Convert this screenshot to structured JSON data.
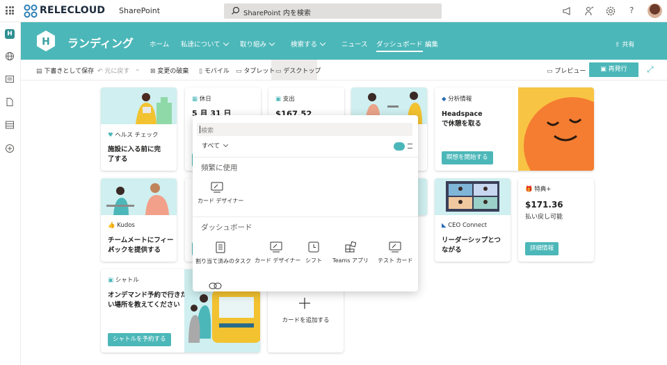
{
  "suite_bar": {
    "brand": "RELECLOUD",
    "product": "SharePoint",
    "search_placeholder": "SharePoint 内を検索"
  },
  "site": {
    "logo_letter": "H",
    "title": "ランディング",
    "nav": [
      {
        "label": "ホーム"
      },
      {
        "label": "私達について"
      },
      {
        "label": "取り組み"
      },
      {
        "label": "検索する"
      },
      {
        "label": "ニュース"
      },
      {
        "label": "ダッシュボード"
      },
      {
        "label": "編集"
      }
    ],
    "share_label": "共有"
  },
  "commands": {
    "save_draft": "下書きとして保存",
    "undo": "元に戻す",
    "discard": "変更の破棄",
    "mobile": "モバイル",
    "tablet": "タブレット",
    "desktop": "デスクトップ",
    "preview": "プレビュー",
    "republish": "再発行"
  },
  "cards": {
    "health": {
      "label": "ヘルス チェック",
      "title_line1": "施設に入る前に完",
      "title_line2": "了する"
    },
    "holiday": {
      "label": "休日",
      "value": "5 月 31 日"
    },
    "expense": {
      "label": "支出",
      "value": "$167.52"
    },
    "analytics": {
      "label": "分析情報",
      "title_line1": "Headspace",
      "title_line2": "で休憩を取る",
      "button": "瞑想を開始する"
    },
    "kudos": {
      "label": "Kudos",
      "title_line1": "チームメートにフィード",
      "title_line2": "バックを提供する"
    },
    "ceo": {
      "label": "CEO Connect",
      "title_line1": "リーダーシップとつ",
      "title_line2": "ながる"
    },
    "perks": {
      "label": "特典+",
      "value": "$171.36",
      "sub": "払い戻し可能",
      "button": "詳細情報"
    },
    "shuttle": {
      "label": "シャトル",
      "title_line1": "オンデマンド予約で行きた",
      "title_line2": "い場所を教えてください",
      "button": "シャトルを予約する"
    },
    "add": {
      "label": "カードを追加する"
    }
  },
  "picker": {
    "search_placeholder": "検索",
    "filter": "すべて",
    "frequent_heading": "頻繁に使用",
    "frequent_items": [
      {
        "label": "カード デザイナー",
        "icon": "card-designer-icon"
      }
    ],
    "dashboard_heading": "ダッシュボード",
    "dashboard_items": [
      {
        "label": "割り当て済みのタスク",
        "icon": "assigned-tasks-icon"
      },
      {
        "label": "カード デザイナー",
        "icon": "card-designer-icon"
      },
      {
        "label": "シフト",
        "icon": "shifts-icon"
      },
      {
        "label": "Teams アプリ",
        "icon": "teams-apps-icon"
      },
      {
        "label": "テスト カード",
        "icon": "test-card-icon"
      }
    ]
  },
  "colors": {
    "accent": "#4cb7b9",
    "headspace_orange": "#f47d31",
    "headspace_yellow": "#f8c444"
  }
}
